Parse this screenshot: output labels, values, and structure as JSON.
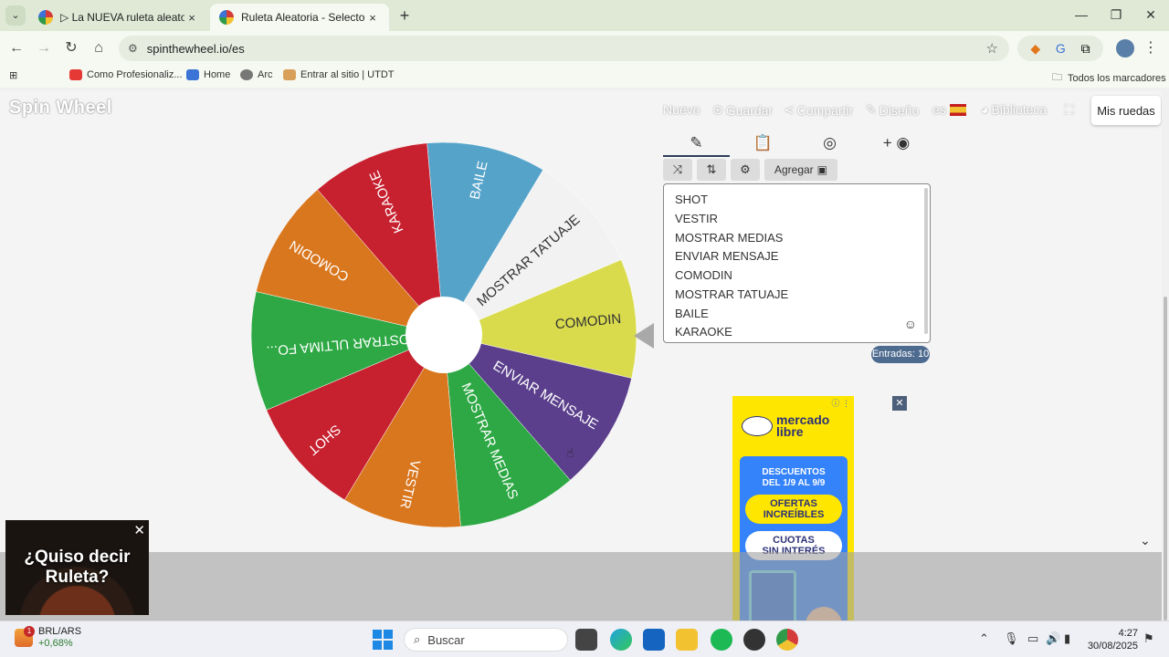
{
  "browser": {
    "tabs": [
      {
        "title": "▷ La NUEVA ruleta aleatoria 💗",
        "close": "×"
      },
      {
        "title": "Ruleta Aleatoria - Selector Persona",
        "close": "×"
      }
    ],
    "new_tab": "+",
    "url": "spinthewheel.io/es",
    "bookmarks": [
      {
        "label": "Como Profesionaliz...",
        "color": "#e53935"
      },
      {
        "label": "Home",
        "color": "#3b73d6"
      },
      {
        "label": "Arc",
        "color": "#777777"
      },
      {
        "label": "Entrar al sitio | UTDT",
        "color": "#d9a05b"
      }
    ],
    "all_bookmarks": "Todos los marcadores"
  },
  "site": {
    "logo": "Spin Wheel",
    "nav": {
      "nuevo": "Nuevo",
      "guardar": "Guardar",
      "compartir": "Compartir",
      "diseno": "Diseño",
      "language": "es",
      "biblioteca": "Biblioteca",
      "mis_ruedas": "Mis ruedas"
    }
  },
  "wheel": {
    "segments": [
      {
        "label": "BAILE",
        "color": "#55a3c9"
      },
      {
        "label": "MOSTRAR TATUAJE",
        "color": "#f2f2f2"
      },
      {
        "label": "COMODIN",
        "color": "#d9db4d"
      },
      {
        "label": "ENVIAR MENSAJE",
        "color": "#5b3f8c"
      },
      {
        "label": "MOSTRAR MEDIAS",
        "color": "#2da844"
      },
      {
        "label": "VESTIR",
        "color": "#d9771f"
      },
      {
        "label": "SHOT",
        "color": "#c7202f"
      },
      {
        "label": "MOSTRAR ULTIMA FO...",
        "color": "#2da844"
      },
      {
        "label": "COMODIN",
        "color": "#d9771f"
      },
      {
        "label": "KARAOKE",
        "color": "#c7202f"
      }
    ]
  },
  "editor": {
    "add_label": "Agregar",
    "entries": [
      "SHOT",
      "VESTIR",
      "MOSTRAR MEDIAS",
      "ENVIAR MENSAJE",
      "COMODIN",
      "MOSTRAR TATUAJE",
      "BAILE",
      "KARAOKE"
    ],
    "count_label": "Entradas: 10"
  },
  "ad": {
    "brand_line1": "mercado",
    "brand_line2": "libre",
    "headline_1": "DESCUENTOS",
    "headline_2": "DEL 1/9 AL 9/9",
    "pill_1a": "OFERTAS",
    "pill_1b": "INCREÍBLES",
    "pill_2a": "CUOTAS",
    "pill_2b": "SIN INTERÉS"
  },
  "video_popup": {
    "line1": "¿Quiso decir",
    "line2": "Ruleta?"
  },
  "taskbar": {
    "widget_title": "BRL/ARS",
    "widget_change": "+0,68%",
    "widget_badge": "1",
    "search_placeholder": "Buscar",
    "time": "4:27",
    "date": "30/08/2025"
  }
}
